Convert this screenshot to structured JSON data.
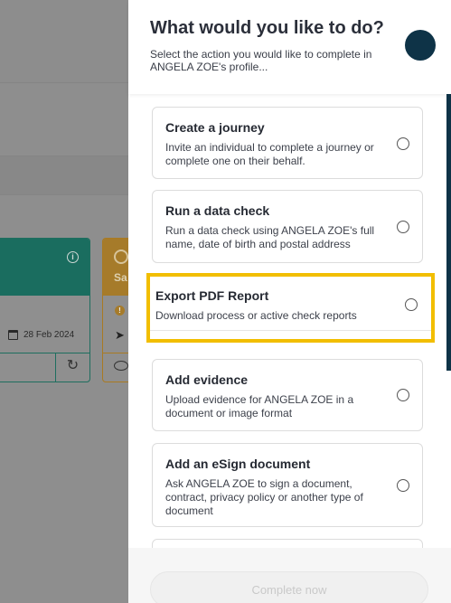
{
  "background": {
    "journey_card": {
      "date": "28 Feb 2024"
    },
    "check_card": {
      "title_fragment": "Sa"
    }
  },
  "panel": {
    "title": "What would you like to do?",
    "subtitle": "Select the action you would like to complete in ANGELA ZOE's profile...",
    "options": [
      {
        "title": "Create a journey",
        "description": "Invite an individual to complete a journey or complete one on their behalf."
      },
      {
        "title": "Run a data check",
        "description": "Run a data check using ANGELA ZOE's full name, date of birth and postal address"
      },
      {
        "title": "Export PDF Report",
        "description": "Download process or active check reports"
      },
      {
        "title": "Add evidence",
        "description": "Upload evidence for ANGELA ZOE in a document or image format"
      },
      {
        "title": "Add an eSign document",
        "description": "Ask ANGELA ZOE to sign a document, contract, privacy policy or another type of document"
      }
    ],
    "complete_button": "Complete now"
  },
  "colors": {
    "accent": "#0e3347",
    "highlight": "#f2be00",
    "green": "#1a6d5f",
    "amber": "#a67b2a"
  }
}
